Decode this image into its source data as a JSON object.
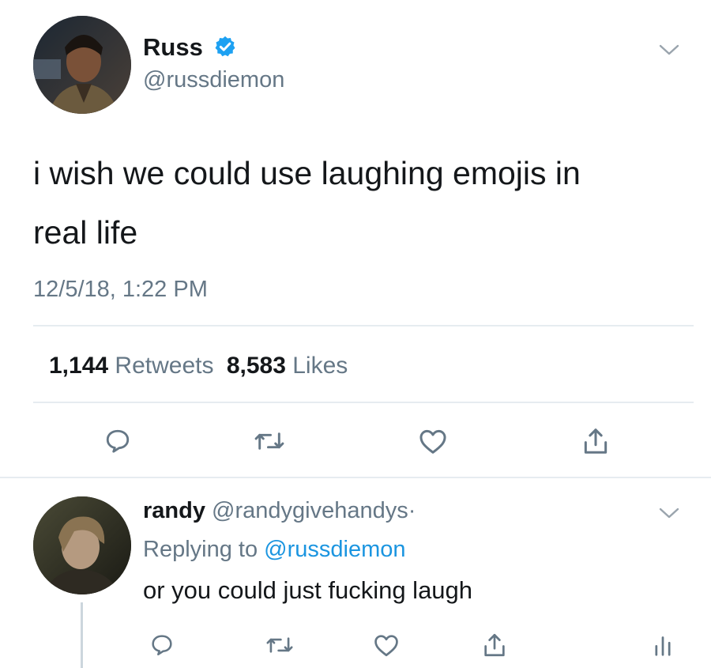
{
  "main_tweet": {
    "display_name": "Russ",
    "handle": "@russdiemon",
    "text_line1": "i wish we could use laughing emojis in",
    "text_line2": "real life",
    "timestamp": "12/5/18, 1:22 PM",
    "retweets_count": "1,144",
    "retweets_label": "Retweets",
    "likes_count": "8,583",
    "likes_label": "Likes"
  },
  "reply": {
    "display_name": "randy",
    "handle": "@randygivehandys",
    "separator": "·",
    "replying_prefix": "Replying to",
    "replying_to": "@russdiemon",
    "text": "or you could just fucking laugh"
  },
  "colors": {
    "verified_blue": "#1da1f2",
    "link_blue": "#1b95e0",
    "muted_gray": "#657786",
    "icon_gray": "#657786",
    "divider": "#e6ecf0"
  },
  "icons": {
    "verified": "verified-badge-icon",
    "chevron": "chevron-down-icon",
    "reply": "reply-icon",
    "retweet": "retweet-icon",
    "like": "heart-icon",
    "share": "share-icon",
    "analytics": "analytics-icon"
  }
}
